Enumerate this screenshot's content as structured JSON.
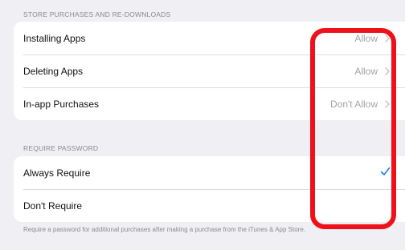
{
  "sections": {
    "store": {
      "header": "STORE PURCHASES AND RE-DOWNLOADS",
      "rows": [
        {
          "label": "Installing Apps",
          "value": "Allow"
        },
        {
          "label": "Deleting Apps",
          "value": "Allow"
        },
        {
          "label": "In-app Purchases",
          "value": "Don't Allow"
        }
      ]
    },
    "password": {
      "header": "REQUIRE PASSWORD",
      "rows": [
        {
          "label": "Always Require",
          "selected": true
        },
        {
          "label": "Don't Require",
          "selected": false
        }
      ],
      "footer": "Require a password for additional purchases after making a purchase from the iTunes & App Store."
    }
  },
  "icons": {
    "chevron": "chevron-right-icon",
    "checkmark": "checkmark-icon"
  },
  "colors": {
    "accent": "#1a7cf4",
    "annotation": "#f0101a",
    "background": "#efeff4",
    "secondary_text": "#a3a3a8"
  }
}
